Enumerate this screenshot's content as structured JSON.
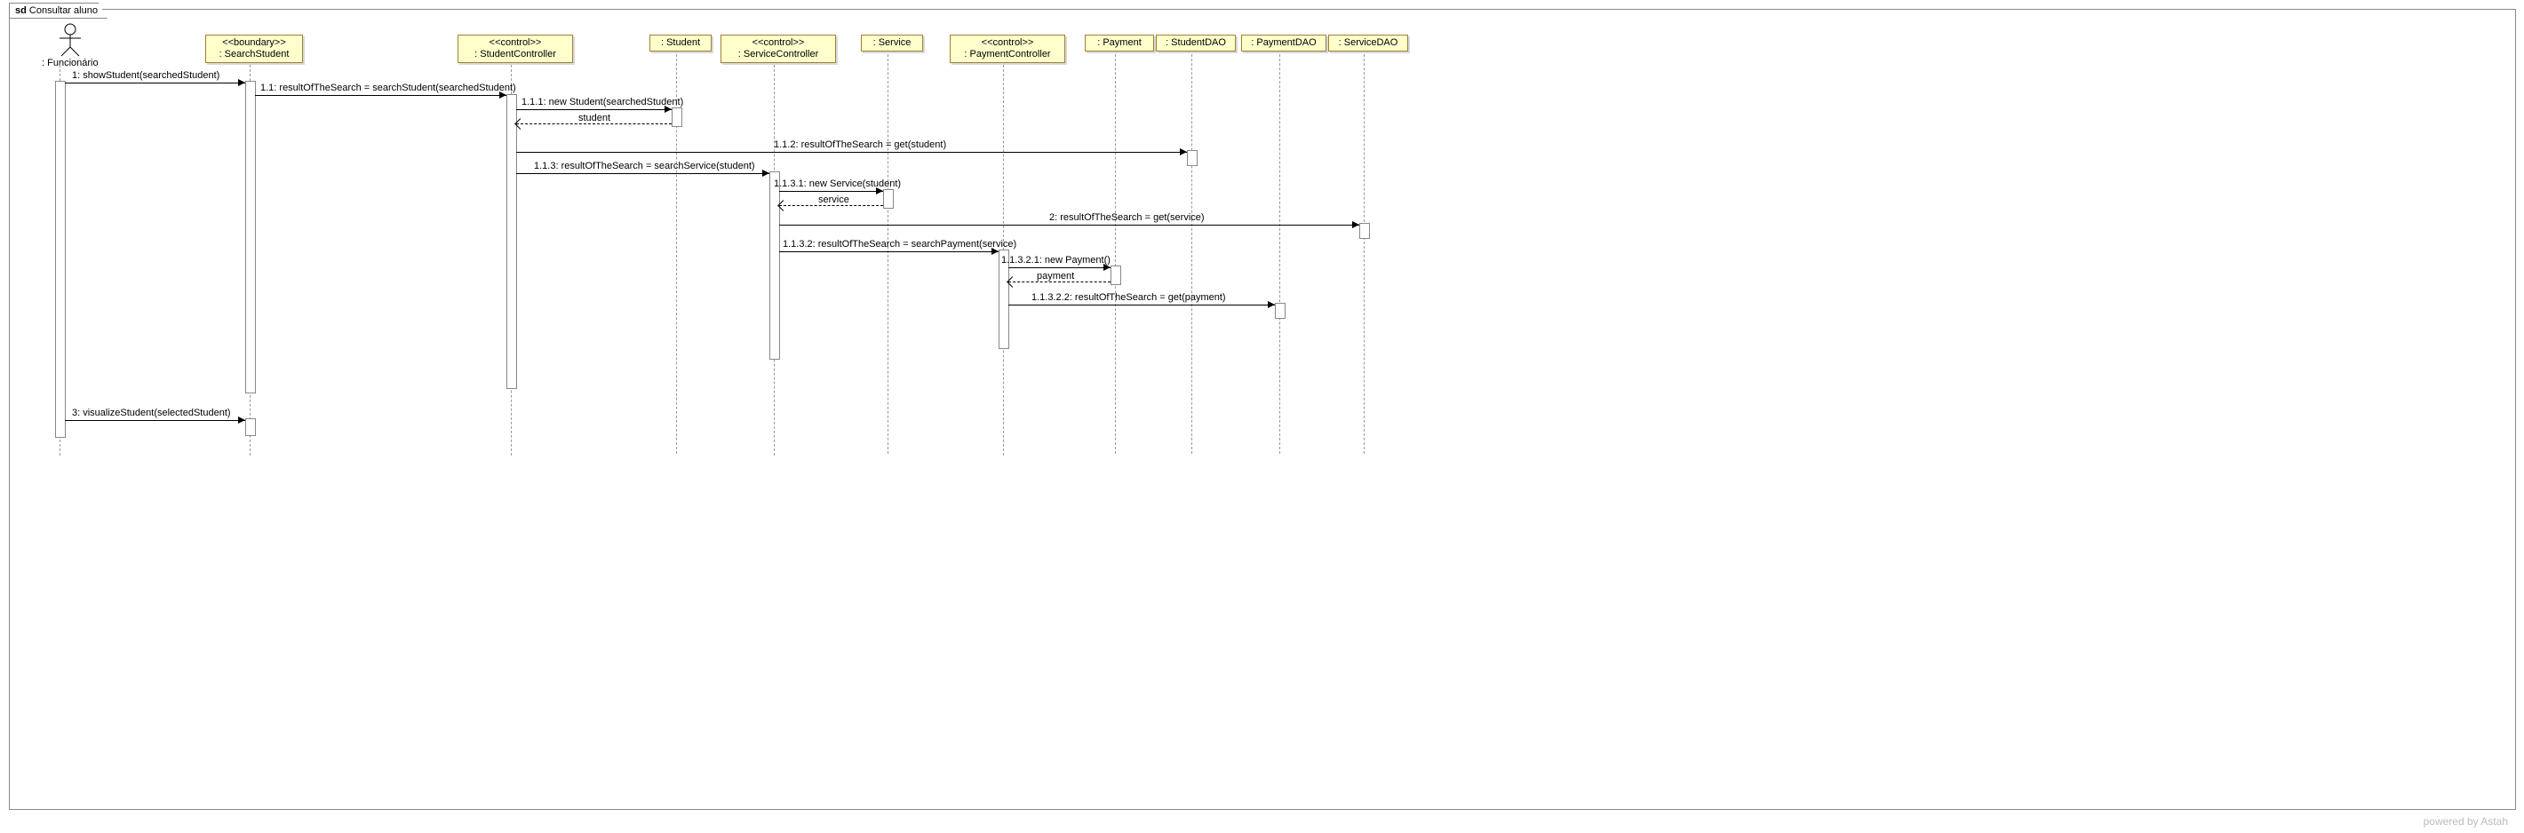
{
  "frame": {
    "prefix": "sd",
    "title": "Consultar aluno"
  },
  "lifelines": {
    "actor": {
      "label": ": Funcionário"
    },
    "l1": {
      "stereotype": "<<boundary>>",
      "name": ": SearchStudent"
    },
    "l2": {
      "stereotype": "<<control>>",
      "name": ": StudentController"
    },
    "l3": {
      "name": ": Student"
    },
    "l4": {
      "stereotype": "<<control>>",
      "name": ": ServiceController"
    },
    "l5": {
      "name": ": Service"
    },
    "l6": {
      "stereotype": "<<control>>",
      "name": ": PaymentController"
    },
    "l7": {
      "name": ": Payment"
    },
    "l8": {
      "name": ": StudentDAO"
    },
    "l9": {
      "name": ": PaymentDAO"
    },
    "l10": {
      "name": ": ServiceDAO"
    }
  },
  "messages": {
    "m1": "1: showStudent(searchedStudent)",
    "m2": "1.1: resultOfTheSearch = searchStudent(searchedStudent)",
    "m3": "1.1.1: new Student(searchedStudent)",
    "r3": "student",
    "m4": "1.1.2: resultOfTheSearch = get(student)",
    "m5": "1.1.3: resultOfTheSearch = searchService(student)",
    "m6": "1.1.3.1: new Service(student)",
    "r6": "service",
    "m7": "2: resultOfTheSearch = get(service)",
    "m8": "1.1.3.2: resultOfTheSearch = searchPayment(service)",
    "m9": "1.1.3.2.1: new Payment()",
    "r9": "payment",
    "m10": "1.1.3.2.2: resultOfTheSearch = get(payment)",
    "m11": "3: visualizeStudent(selectedStudent)"
  },
  "footer": "powered by Astah",
  "chart_data": {
    "type": "uml-sequence-diagram",
    "title": "Consultar aluno",
    "lifelines": [
      {
        "id": "actor",
        "name": "Funcionário",
        "kind": "actor"
      },
      {
        "id": "SearchStudent",
        "name": "SearchStudent",
        "stereotype": "boundary"
      },
      {
        "id": "StudentController",
        "name": "StudentController",
        "stereotype": "control"
      },
      {
        "id": "Student",
        "name": "Student"
      },
      {
        "id": "ServiceController",
        "name": "ServiceController",
        "stereotype": "control"
      },
      {
        "id": "Service",
        "name": "Service"
      },
      {
        "id": "PaymentController",
        "name": "PaymentController",
        "stereotype": "control"
      },
      {
        "id": "Payment",
        "name": "Payment"
      },
      {
        "id": "StudentDAO",
        "name": "StudentDAO"
      },
      {
        "id": "PaymentDAO",
        "name": "PaymentDAO"
      },
      {
        "id": "ServiceDAO",
        "name": "ServiceDAO"
      }
    ],
    "messages": [
      {
        "seq": "1",
        "from": "actor",
        "to": "SearchStudent",
        "label": "showStudent(searchedStudent)",
        "type": "sync"
      },
      {
        "seq": "1.1",
        "from": "SearchStudent",
        "to": "StudentController",
        "label": "resultOfTheSearch = searchStudent(searchedStudent)",
        "type": "sync"
      },
      {
        "seq": "1.1.1",
        "from": "StudentController",
        "to": "Student",
        "label": "new Student(searchedStudent)",
        "type": "create"
      },
      {
        "seq": "1.1.1.r",
        "from": "Student",
        "to": "StudentController",
        "label": "student",
        "type": "return"
      },
      {
        "seq": "1.1.2",
        "from": "StudentController",
        "to": "StudentDAO",
        "label": "resultOfTheSearch = get(student)",
        "type": "sync"
      },
      {
        "seq": "1.1.3",
        "from": "StudentController",
        "to": "ServiceController",
        "label": "resultOfTheSearch = searchService(student)",
        "type": "sync"
      },
      {
        "seq": "1.1.3.1",
        "from": "ServiceController",
        "to": "Service",
        "label": "new Service(student)",
        "type": "create"
      },
      {
        "seq": "1.1.3.1.r",
        "from": "Service",
        "to": "ServiceController",
        "label": "service",
        "type": "return"
      },
      {
        "seq": "2",
        "from": "ServiceController",
        "to": "ServiceDAO",
        "label": "resultOfTheSearch = get(service)",
        "type": "sync"
      },
      {
        "seq": "1.1.3.2",
        "from": "ServiceController",
        "to": "PaymentController",
        "label": "resultOfTheSearch = searchPayment(service)",
        "type": "sync"
      },
      {
        "seq": "1.1.3.2.1",
        "from": "PaymentController",
        "to": "Payment",
        "label": "new Payment()",
        "type": "create"
      },
      {
        "seq": "1.1.3.2.1.r",
        "from": "Payment",
        "to": "PaymentController",
        "label": "payment",
        "type": "return"
      },
      {
        "seq": "1.1.3.2.2",
        "from": "PaymentController",
        "to": "PaymentDAO",
        "label": "resultOfTheSearch = get(payment)",
        "type": "sync"
      },
      {
        "seq": "3",
        "from": "actor",
        "to": "SearchStudent",
        "label": "visualizeStudent(selectedStudent)",
        "type": "sync"
      }
    ]
  }
}
